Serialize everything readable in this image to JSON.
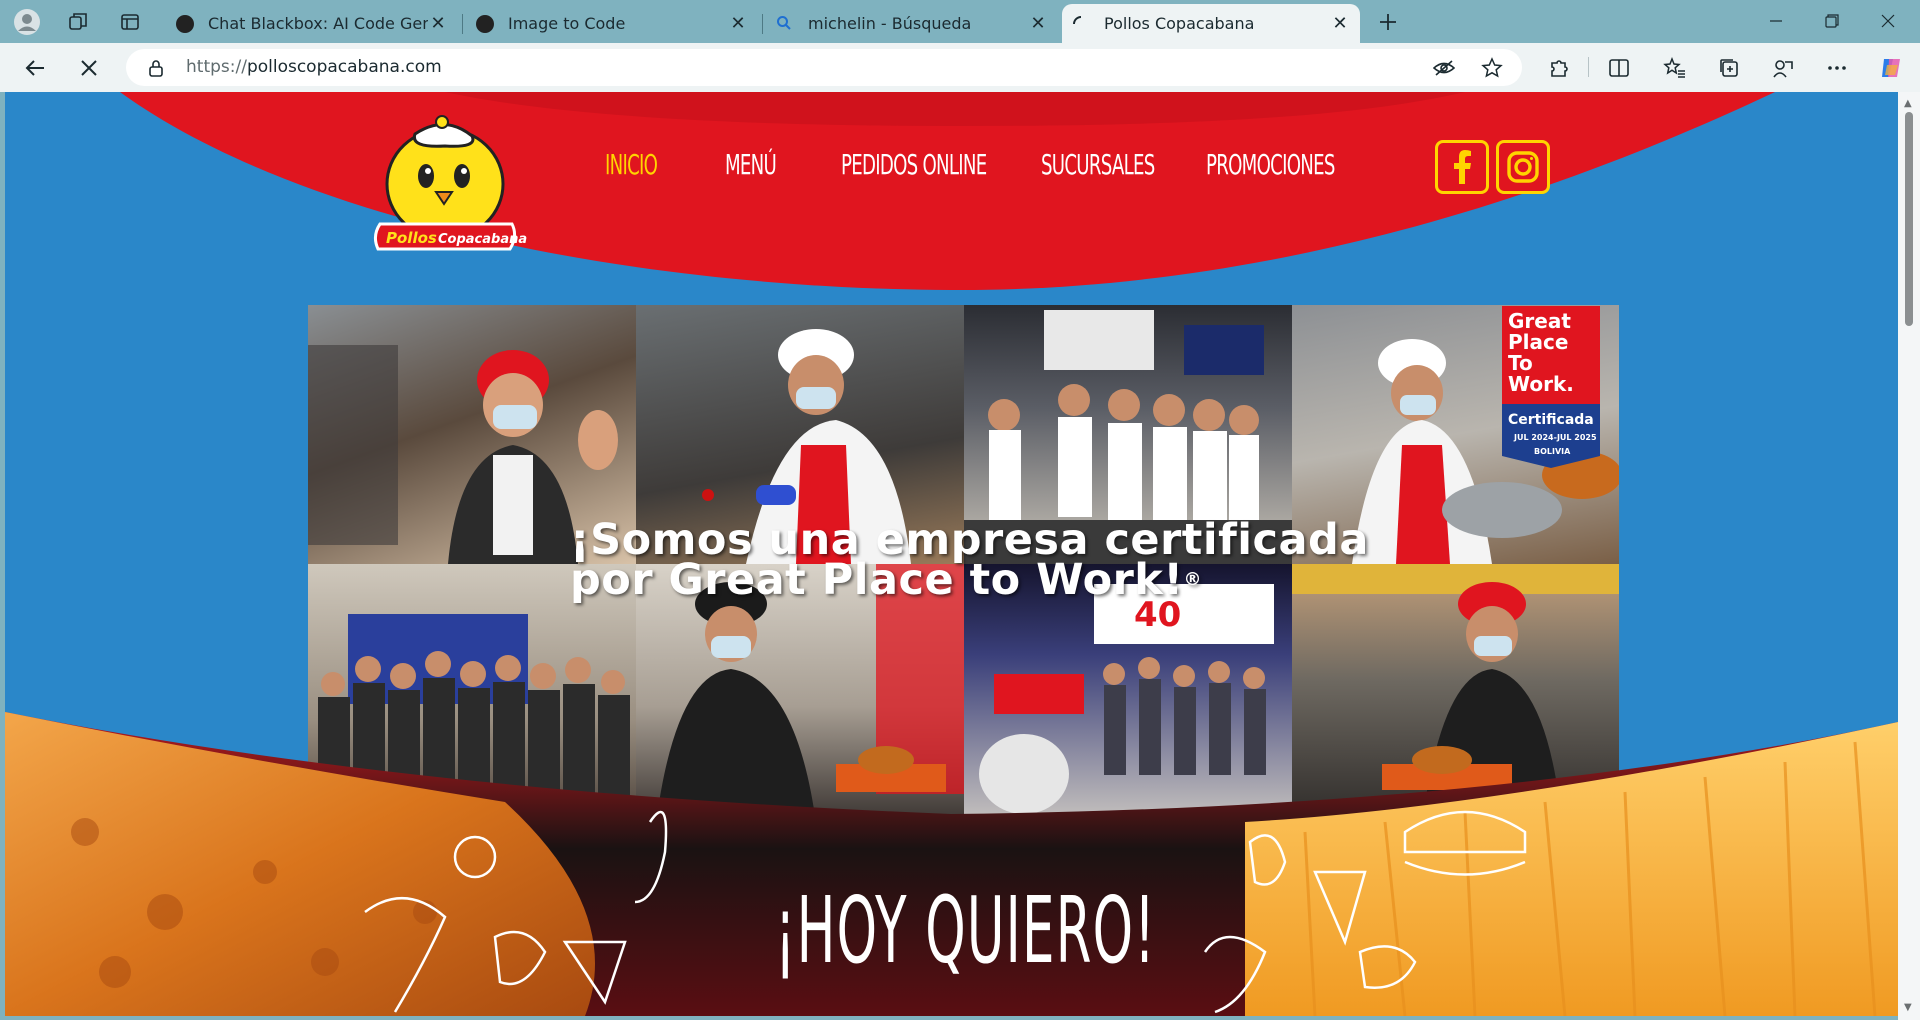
{
  "browser": {
    "tabs": [
      {
        "title": "Chat Blackbox: AI Code Generatio",
        "active": false
      },
      {
        "title": "Image to Code",
        "active": false
      },
      {
        "title": "michelin - Búsqueda",
        "active": false
      },
      {
        "title": "Pollos Copacabana",
        "active": true
      }
    ],
    "url_scheme": "https://",
    "url_host": "polloscopacabana.com",
    "icons": [
      "profile-icon",
      "workspaces-icon",
      "tab-actions-icon",
      "new-tab-icon",
      "back-icon",
      "stop-loading-icon",
      "lock-icon",
      "tracking-prevention-icon",
      "favorite-star-icon",
      "extensions-icon",
      "split-screen-icon",
      "favorites-icon",
      "collections-icon",
      "browser-essentials-icon",
      "more-icon",
      "copilot-icon",
      "minimize-icon",
      "restore-icon",
      "close-window-icon"
    ]
  },
  "site": {
    "logo_text_1": "Pollos",
    "logo_text_2": "Copacabana",
    "nav": [
      {
        "label": "INICIO",
        "active": true
      },
      {
        "label": "MENÚ",
        "active": false
      },
      {
        "label": "PEDIDOS ONLINE",
        "active": false
      },
      {
        "label": "SUCURSALES",
        "active": false
      },
      {
        "label": "PROMOCIONES",
        "active": false
      }
    ],
    "social": [
      "facebook-icon",
      "instagram-icon"
    ],
    "headline_line1": "¡Somos una empresa certificada",
    "headline_line2": "por Great Place to Work!",
    "headline_mark": "®",
    "badge": {
      "line1": "Great",
      "line2": "Place",
      "line3": "To",
      "line4": "Work.",
      "line5": "Certificada",
      "line6": "JUL 2024-JUL 2025",
      "line7": "BOLIVIA"
    },
    "banner_text": "¡HOY QUIERO!",
    "colors": {
      "brand_red": "#e0151f",
      "brand_yellow": "#ffd400",
      "sky_blue": "#2a87c9"
    }
  }
}
